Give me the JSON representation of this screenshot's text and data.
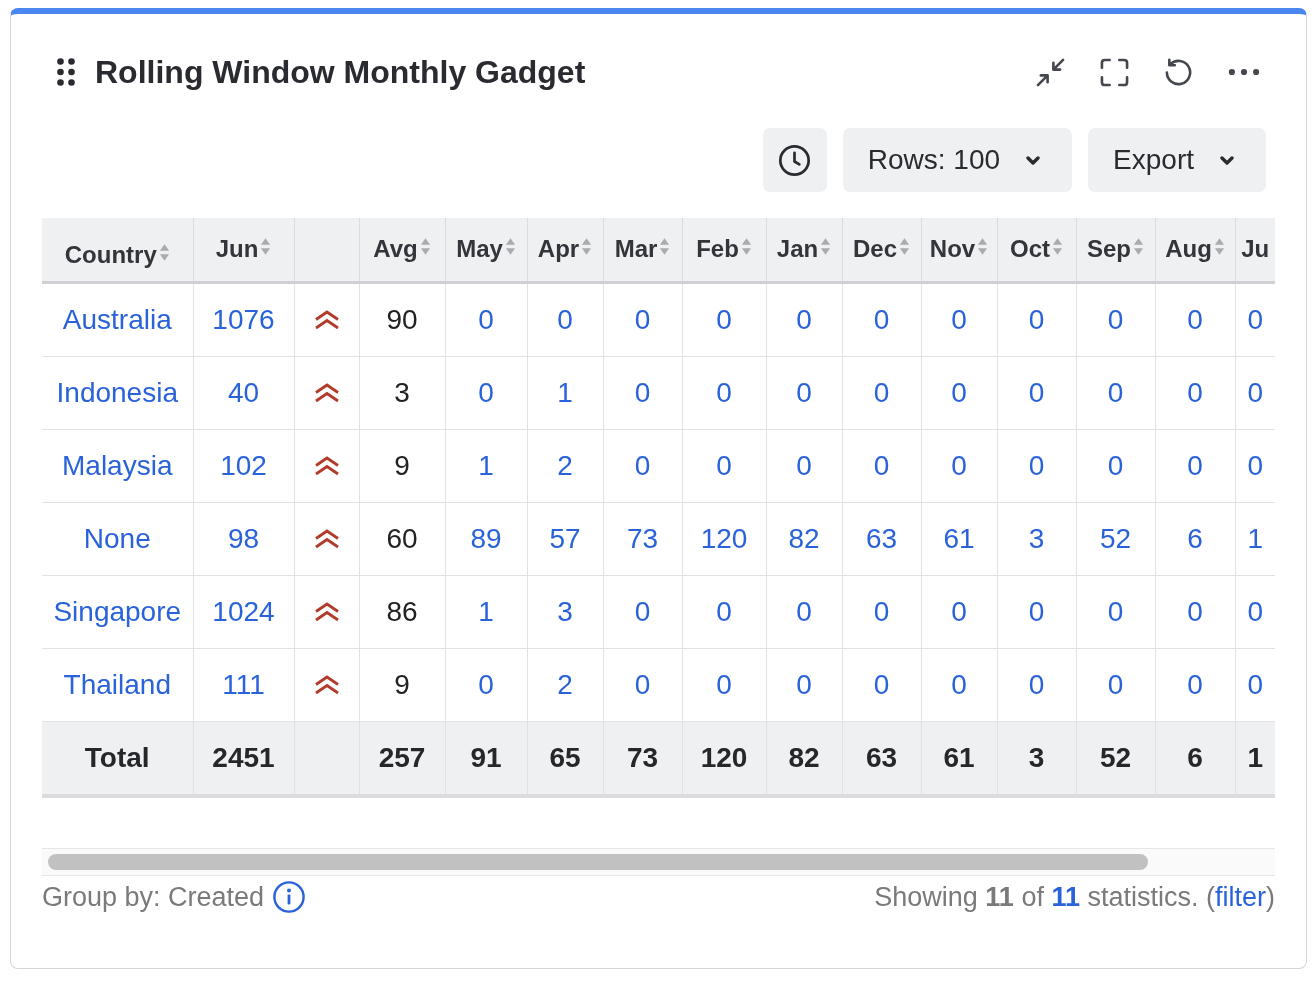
{
  "header": {
    "title": "Rolling Window Monthly Gadget"
  },
  "toolbar": {
    "buttons": [
      {
        "kind": "history"
      },
      {
        "kind": "dropdown",
        "label": "Rows: 100"
      },
      {
        "kind": "dropdown",
        "label": "Export"
      }
    ]
  },
  "table": {
    "columns": [
      {
        "kind": "text",
        "label": "Country",
        "sort_icon": true,
        "link": true
      },
      {
        "kind": "text",
        "label": "Jun",
        "sort_icon": true,
        "link": true
      },
      {
        "kind": "trend"
      },
      {
        "kind": "text",
        "label": "Avg",
        "sort_icon": true,
        "link": false
      },
      {
        "kind": "text",
        "label": "May",
        "sort_icon": true,
        "link": true
      },
      {
        "kind": "text",
        "label": "Apr",
        "sort_icon": true,
        "link": true
      },
      {
        "kind": "text",
        "label": "Mar",
        "sort_icon": true,
        "link": true
      },
      {
        "kind": "text",
        "label": "Feb",
        "sort_icon": true,
        "link": true
      },
      {
        "kind": "text",
        "label": "Jan",
        "sort_icon": true,
        "link": true
      },
      {
        "kind": "text",
        "label": "Dec",
        "sort_icon": true,
        "link": true
      },
      {
        "kind": "text",
        "label": "Nov",
        "sort_icon": true,
        "link": true
      },
      {
        "kind": "text",
        "label": "Oct",
        "sort_icon": true,
        "link": true
      },
      {
        "kind": "text",
        "label": "Sep",
        "sort_icon": true,
        "link": true
      },
      {
        "kind": "text",
        "label": "Aug",
        "sort_icon": true,
        "link": true
      },
      {
        "kind": "text",
        "label": "Ju",
        "sort_icon": false,
        "link": true
      }
    ],
    "rows": [
      {
        "cells": [
          "Australia",
          "1076",
          "",
          "90",
          "0",
          "0",
          "0",
          "0",
          "0",
          "0",
          "0",
          "0",
          "0",
          "0",
          "0"
        ]
      },
      {
        "cells": [
          "Indonesia",
          "40",
          "",
          "3",
          "0",
          "1",
          "0",
          "0",
          "0",
          "0",
          "0",
          "0",
          "0",
          "0",
          "0"
        ]
      },
      {
        "cells": [
          "Malaysia",
          "102",
          "",
          "9",
          "1",
          "2",
          "0",
          "0",
          "0",
          "0",
          "0",
          "0",
          "0",
          "0",
          "0"
        ]
      },
      {
        "cells": [
          "None",
          "98",
          "",
          "60",
          "89",
          "57",
          "73",
          "120",
          "82",
          "63",
          "61",
          "3",
          "52",
          "6",
          "1"
        ]
      },
      {
        "cells": [
          "Singapore",
          "1024",
          "",
          "86",
          "1",
          "3",
          "0",
          "0",
          "0",
          "0",
          "0",
          "0",
          "0",
          "0",
          "0"
        ]
      },
      {
        "cells": [
          "Thailand",
          "111",
          "",
          "9",
          "0",
          "2",
          "0",
          "0",
          "0",
          "0",
          "0",
          "0",
          "0",
          "0",
          "0"
        ]
      }
    ],
    "total": {
      "cells": [
        "Total",
        "2451",
        "",
        "257",
        "91",
        "65",
        "73",
        "120",
        "82",
        "63",
        "61",
        "3",
        "52",
        "6",
        "1"
      ]
    }
  },
  "footer": {
    "group_by": "Group by: Created",
    "summary": {
      "before": "Showing **11** of",
      "count": "11",
      "after": "statistics. (",
      "link": "filter",
      "end": ")"
    }
  }
}
